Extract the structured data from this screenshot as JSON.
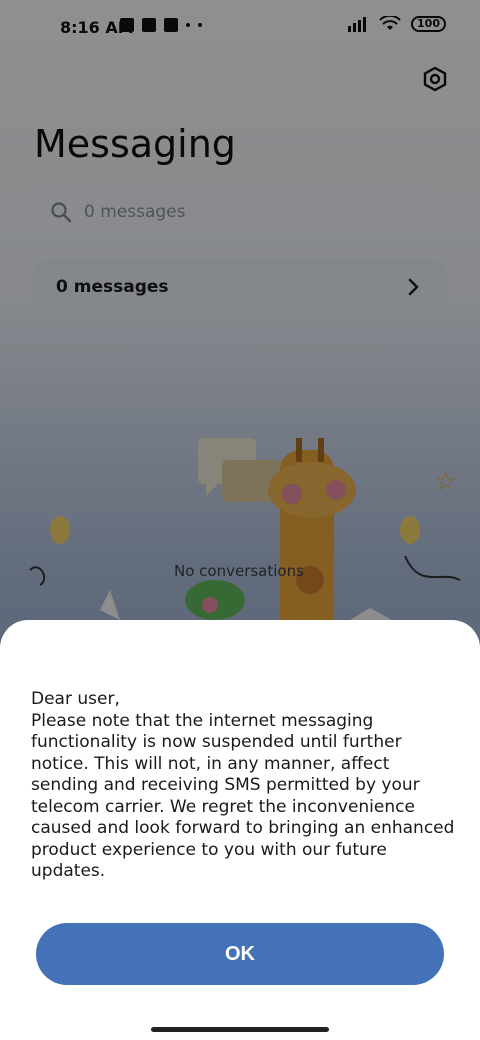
{
  "status_bar": {
    "time": "8:16 AM",
    "battery": "100"
  },
  "app": {
    "title": "Messaging",
    "search_placeholder": "0 messages",
    "bar_label": "0 messages",
    "empty_text": "No conversations"
  },
  "dialog": {
    "message": "Dear user,\nPlease note that the internet messaging functionality is now suspended until further notice. This will not, in any manner, affect sending and receiving SMS permitted by your telecom carrier. We regret the inconvenience caused and look forward to bringing an enhanced product experience to you with our future updates.",
    "ok_label": "OK"
  },
  "colors": {
    "accent": "#4472b9",
    "scrim": "#000000"
  },
  "icons": [
    "settings-icon",
    "search-icon",
    "chevron-right-icon",
    "wifi-icon",
    "signal-icon",
    "battery-icon"
  ]
}
